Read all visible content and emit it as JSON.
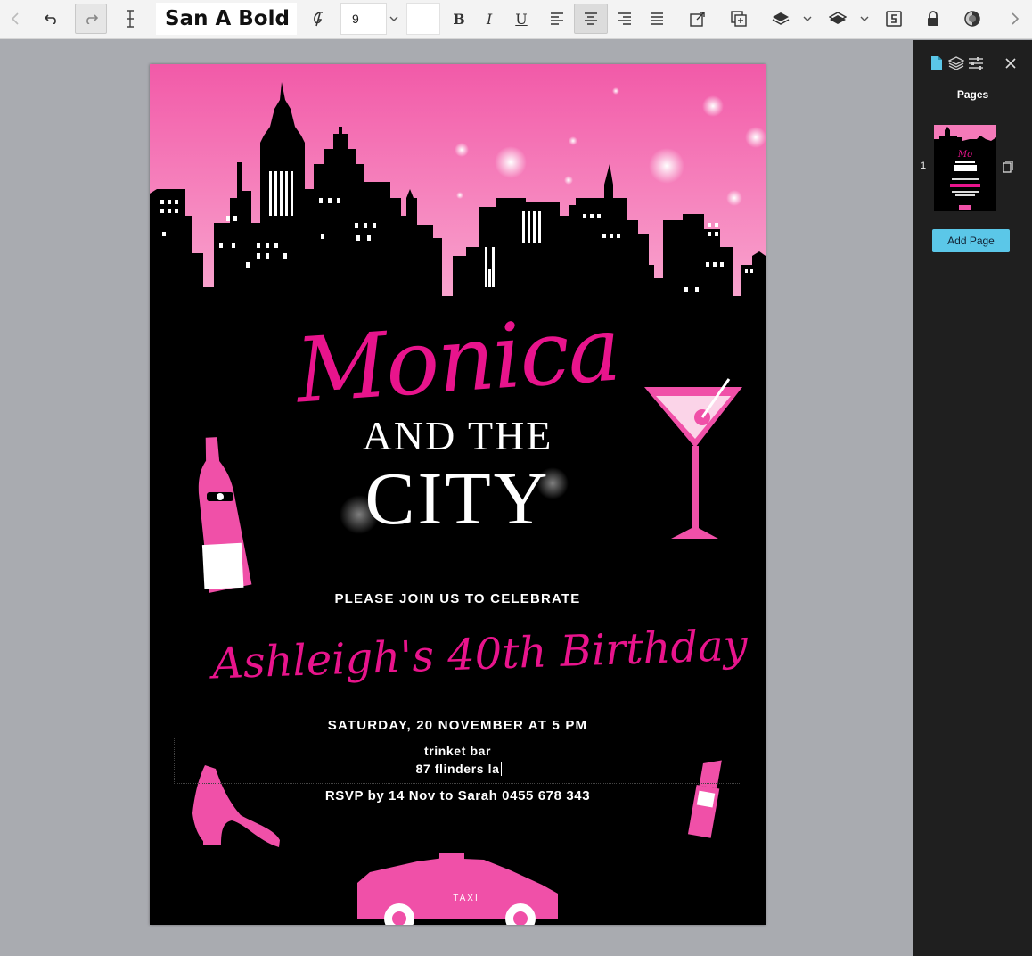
{
  "toolbar": {
    "font_name": "San A Bold",
    "font_size": "9",
    "bold_label": "B",
    "italic_label": "I",
    "underline_label": "U"
  },
  "invitation": {
    "script_title": "Monica",
    "title_line1": "AND THE",
    "title_line2": "CITY",
    "join_text": "PLEASE JOIN US TO CELEBRATE",
    "honoree_script": "Ashleigh's 40th Birthday",
    "date_text": "SATURDAY, 20 NOVEMBER AT 5 PM",
    "venue_line1": "trinket bar",
    "venue_line2": "87 flinders la",
    "rsvp_text": "RSVP by 14 Nov to Sarah 0455 678 343",
    "taxi_label": "TAXI"
  },
  "sidebar": {
    "pages_title": "Pages",
    "page_number": "1",
    "add_page_label": "Add Page"
  },
  "colors": {
    "accent_pink": "#e8148c",
    "sky_pink": "#f47ab9",
    "button_blue": "#5bc7e8"
  }
}
